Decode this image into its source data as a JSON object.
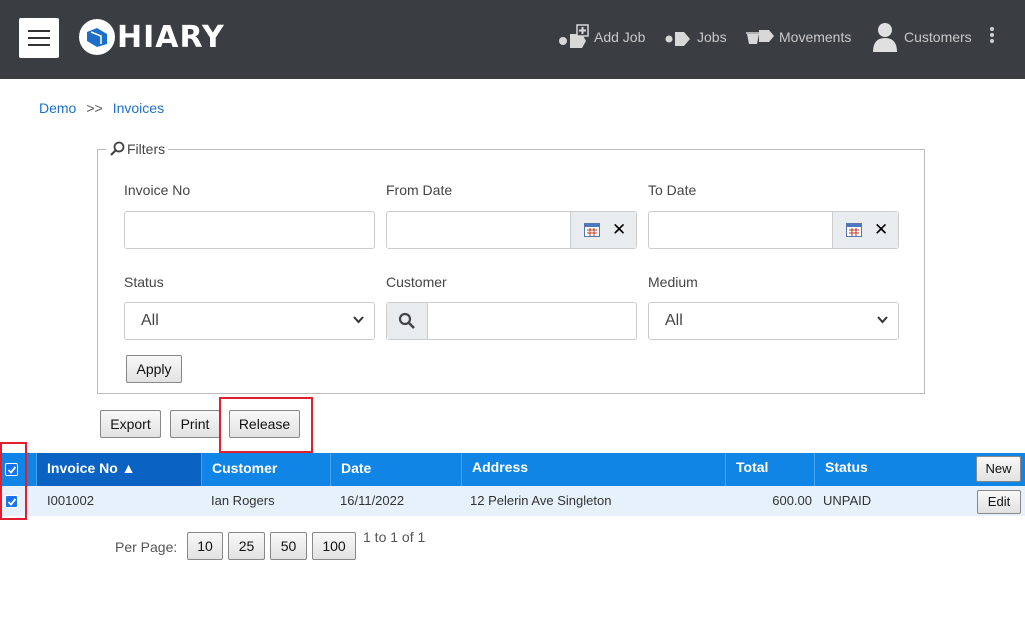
{
  "app": {
    "logo_text": "HIARY"
  },
  "nav": {
    "add_job": "Add Job",
    "jobs": "Jobs",
    "movements": "Movements",
    "customers": "Customers"
  },
  "breadcrumb": {
    "root": "Demo",
    "separator": ">>",
    "current": "Invoices"
  },
  "filters": {
    "legend": "Filters",
    "invoice_no_label": "Invoice No",
    "invoice_no_value": "",
    "from_date_label": "From Date",
    "from_date_value": "",
    "to_date_label": "To Date",
    "to_date_value": "",
    "status_label": "Status",
    "status_value": "All",
    "customer_label": "Customer",
    "customer_value": "",
    "medium_label": "Medium",
    "medium_value": "All",
    "apply_label": "Apply"
  },
  "actions": {
    "export": "Export",
    "print": "Print",
    "release": "Release"
  },
  "table": {
    "columns": [
      "Invoice No ▲",
      "Customer",
      "Date",
      "Address",
      "Total",
      "Status"
    ],
    "new_label": "New",
    "rows": [
      {
        "invoice_no": "I001002",
        "customer": "Ian Rogers",
        "date": "16/11/2022",
        "address": "12 Pelerin Ave Singleton",
        "total": "600.00",
        "status": "UNPAID",
        "checked": true,
        "edit_label": "Edit"
      }
    ]
  },
  "pager": {
    "label": "Per Page:",
    "sizes": [
      "10",
      "25",
      "50",
      "100"
    ],
    "count_text": "1 to 1 of 1"
  },
  "colors": {
    "header_bg": "#3a3d42",
    "table_header": "#1185e6",
    "highlight": "#e0202e",
    "link": "#1b6fc8"
  }
}
